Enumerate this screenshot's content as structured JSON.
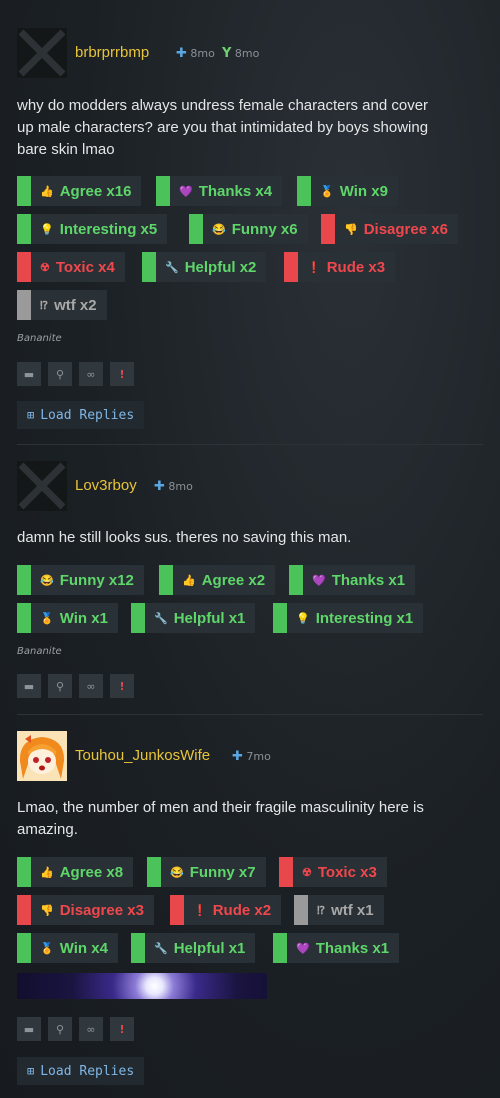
{
  "posts": [
    {
      "username": "brbrprrbmp",
      "meta": [
        {
          "icon": "plus-icon",
          "text": "8mo"
        },
        {
          "icon": "trophy-icon",
          "text": "8mo"
        }
      ],
      "text_lines": [
        "why do modders always undress female characters and cover",
        "up male characters? are you that intimidated by boys showing",
        "bare skin lmao"
      ],
      "ratings": [
        {
          "emoji": "👍",
          "label": "Agree x16",
          "tone": "green"
        },
        {
          "emoji": "💜",
          "label": "Thanks x4",
          "tone": "green"
        },
        {
          "emoji": "🏅",
          "label": "Win x9",
          "tone": "green"
        },
        {
          "emoji": "💡",
          "label": "Interesting x5",
          "tone": "green"
        },
        {
          "emoji": "😂",
          "label": "Funny x6",
          "tone": "green"
        },
        {
          "emoji": "👎",
          "label": "Disagree x6",
          "tone": "red"
        },
        {
          "emoji": "☢",
          "label": "Toxic x4",
          "tone": "red"
        },
        {
          "emoji": "🔧",
          "label": "Helpful x2",
          "tone": "green"
        },
        {
          "emoji": "❗",
          "label": "Rude x3",
          "tone": "red"
        },
        {
          "emoji": "⁉",
          "label": "wtf x2",
          "tone": "neutral"
        }
      ],
      "signature": "Bananite",
      "load_replies": "Load Replies"
    },
    {
      "username": "Lov3rboy",
      "meta": [
        {
          "icon": "plus-icon",
          "text": "8mo"
        }
      ],
      "text_lines": [
        "damn he still looks sus. theres no saving this man."
      ],
      "ratings": [
        {
          "emoji": "😂",
          "label": "Funny x12",
          "tone": "green"
        },
        {
          "emoji": "👍",
          "label": "Agree x2",
          "tone": "green"
        },
        {
          "emoji": "💜",
          "label": "Thanks x1",
          "tone": "green"
        },
        {
          "emoji": "🏅",
          "label": "Win x1",
          "tone": "green"
        },
        {
          "emoji": "🔧",
          "label": "Helpful x1",
          "tone": "green"
        },
        {
          "emoji": "💡",
          "label": "Interesting x1",
          "tone": "green"
        }
      ],
      "signature": "Bananite"
    },
    {
      "username": "Touhou_JunkosWife",
      "meta": [
        {
          "icon": "plus-icon",
          "text": "7mo"
        }
      ],
      "text_lines": [
        "Lmao, the number of men and their fragile masculinity here is",
        "amazing."
      ],
      "ratings": [
        {
          "emoji": "👍",
          "label": "Agree x8",
          "tone": "green"
        },
        {
          "emoji": "😂",
          "label": "Funny x7",
          "tone": "green"
        },
        {
          "emoji": "☢",
          "label": "Toxic x3",
          "tone": "red"
        },
        {
          "emoji": "👎",
          "label": "Disagree x3",
          "tone": "red"
        },
        {
          "emoji": "❗",
          "label": "Rude x2",
          "tone": "red"
        },
        {
          "emoji": "⁉",
          "label": "wtf x1",
          "tone": "neutral"
        },
        {
          "emoji": "🏅",
          "label": "Win x4",
          "tone": "green"
        },
        {
          "emoji": "🔧",
          "label": "Helpful x1",
          "tone": "green"
        },
        {
          "emoji": "💜",
          "label": "Thanks x1",
          "tone": "green"
        }
      ],
      "load_replies": "Load Replies"
    }
  ],
  "actions": [
    {
      "icon": "comment-icon",
      "glyph": "▬"
    },
    {
      "icon": "user-icon",
      "glyph": "⚲"
    },
    {
      "icon": "link-icon",
      "glyph": "∞"
    },
    {
      "icon": "report-icon",
      "glyph": "!"
    }
  ],
  "colors": {
    "green": "#4bc25a",
    "red": "#e8474c",
    "neutral": "#9a9a9a",
    "username": "#e8c43a"
  }
}
